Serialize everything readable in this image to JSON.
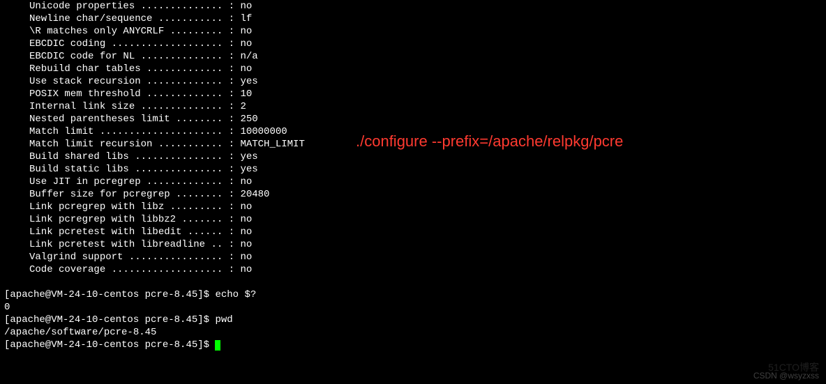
{
  "config_lines": [
    {
      "label": "Unicode properties ..............",
      "value": "no"
    },
    {
      "label": "Newline char/sequence ...........",
      "value": "lf"
    },
    {
      "label": "\\R matches only ANYCRLF .........",
      "value": "no"
    },
    {
      "label": "EBCDIC coding ...................",
      "value": "no"
    },
    {
      "label": "EBCDIC code for NL ..............",
      "value": "n/a"
    },
    {
      "label": "Rebuild char tables .............",
      "value": "no"
    },
    {
      "label": "Use stack recursion .............",
      "value": "yes"
    },
    {
      "label": "POSIX mem threshold .............",
      "value": "10"
    },
    {
      "label": "Internal link size ..............",
      "value": "2"
    },
    {
      "label": "Nested parentheses limit ........",
      "value": "250"
    },
    {
      "label": "Match limit .....................",
      "value": "10000000"
    },
    {
      "label": "Match limit recursion ...........",
      "value": "MATCH_LIMIT"
    },
    {
      "label": "Build shared libs ...............",
      "value": "yes"
    },
    {
      "label": "Build static libs ...............",
      "value": "yes"
    },
    {
      "label": "Use JIT in pcregrep .............",
      "value": "no"
    },
    {
      "label": "Buffer size for pcregrep ........",
      "value": "20480"
    },
    {
      "label": "Link pcregrep with libz .........",
      "value": "no"
    },
    {
      "label": "Link pcregrep with libbz2 .......",
      "value": "no"
    },
    {
      "label": "Link pcretest with libedit ......",
      "value": "no"
    },
    {
      "label": "Link pcretest with libreadline ..",
      "value": "no"
    },
    {
      "label": "Valgrind support ................",
      "value": "no"
    },
    {
      "label": "Code coverage ...................",
      "value": "no"
    }
  ],
  "prompts": {
    "p1": "[apache@VM-24-10-centos pcre-8.45]$ echo $?",
    "r1": "0",
    "p2": "[apache@VM-24-10-centos pcre-8.45]$ pwd",
    "r2": "/apache/software/pcre-8.45",
    "p3": "[apache@VM-24-10-centos pcre-8.45]$ "
  },
  "annotation": "./configure --prefix=/apache/relpkg/pcre",
  "watermarks": {
    "bottom_cto": "51CTO博客",
    "bottom_csdn": "CSDN @wsyzxss"
  }
}
